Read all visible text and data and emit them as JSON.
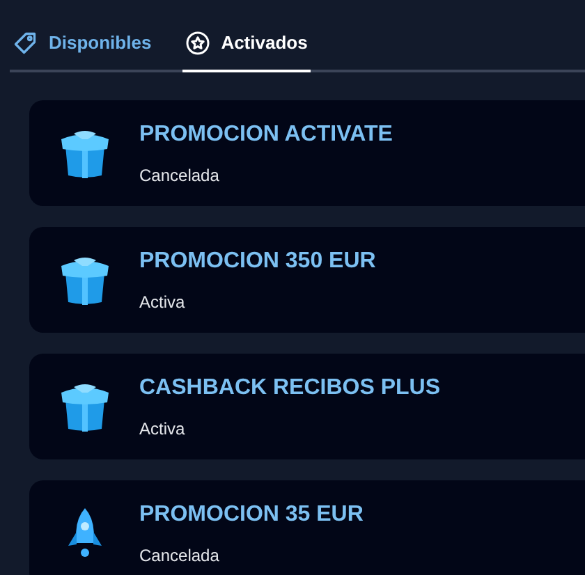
{
  "tabs": [
    {
      "label": "Disponibles",
      "kind": "tag",
      "selected": false
    },
    {
      "label": "Activados",
      "kind": "star",
      "selected": true
    }
  ],
  "promotions": [
    {
      "title": "PROMOCION ACTIVATE",
      "status": "Cancelada",
      "kind": "gift"
    },
    {
      "title": "PROMOCION 350 EUR",
      "status": "Activa",
      "kind": "gift"
    },
    {
      "title": "CASHBACK RECIBOS PLUS",
      "status": "Activa",
      "kind": "gift"
    },
    {
      "title": "PROMOCION 35 EUR",
      "status": "Cancelada",
      "kind": "rocket"
    }
  ]
}
